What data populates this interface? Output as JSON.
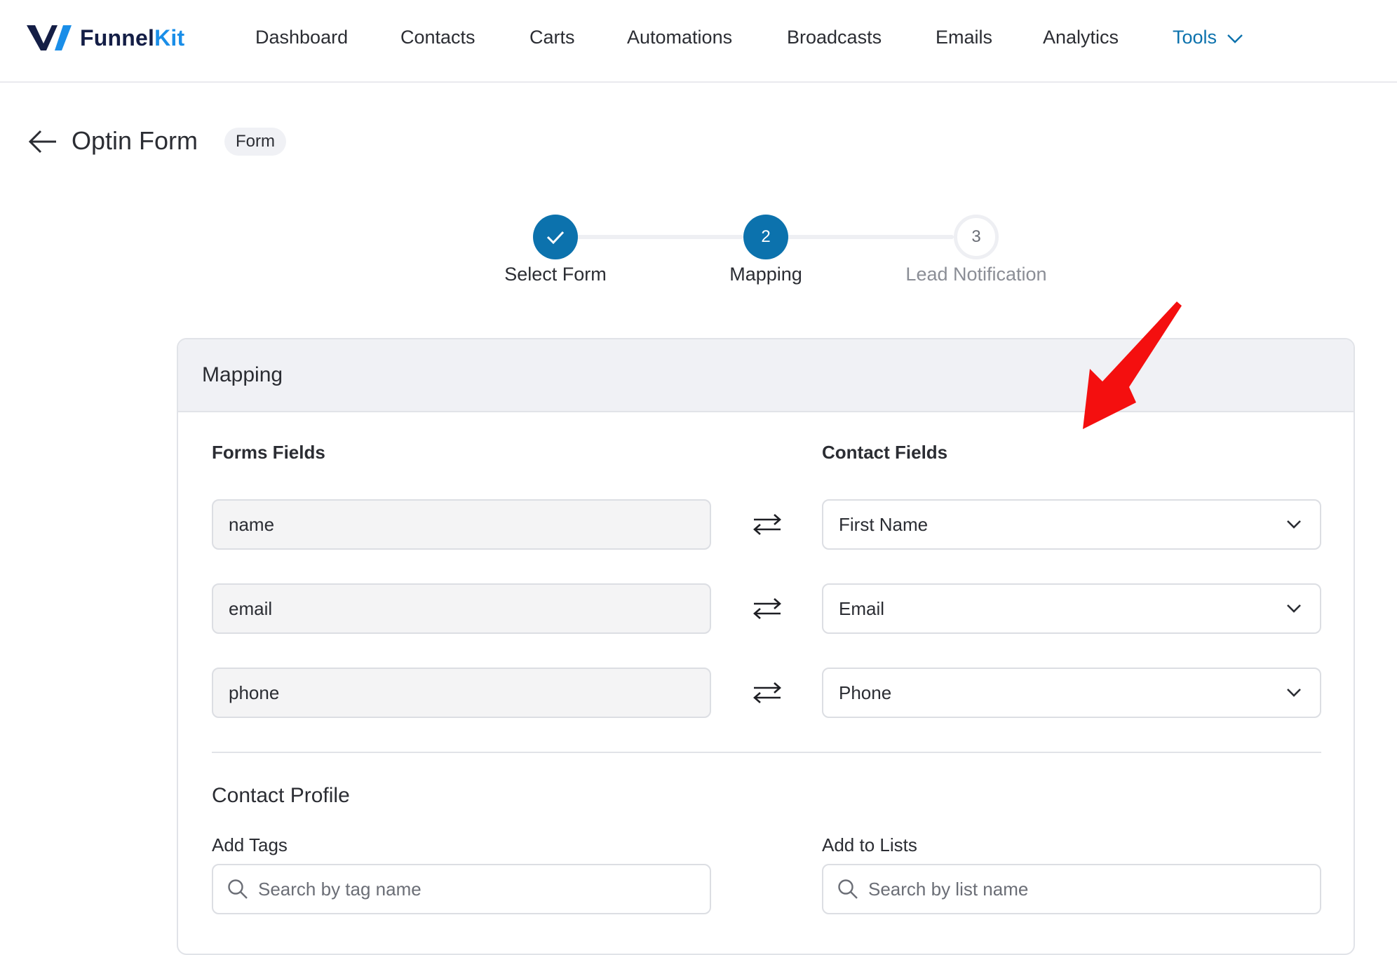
{
  "brand": {
    "part1": "Funnel",
    "part2": "Kit",
    "accent": "#1a8ee8",
    "dark": "#141e46"
  },
  "nav": {
    "items": [
      "Dashboard",
      "Contacts",
      "Carts",
      "Automations",
      "Broadcasts",
      "Emails",
      "Analytics"
    ],
    "tools": "Tools",
    "active_color": "#0c72ad"
  },
  "header": {
    "title": "Optin Form",
    "badge": "Form"
  },
  "stepper": {
    "steps": [
      {
        "number": "1",
        "label": "Select Form",
        "state": "done"
      },
      {
        "number": "2",
        "label": "Mapping",
        "state": "current"
      },
      {
        "number": "3",
        "label": "Lead Notification",
        "state": "pending"
      }
    ]
  },
  "card": {
    "title": "Mapping",
    "forms_fields_heading": "Forms Fields",
    "contact_fields_heading": "Contact Fields",
    "rows": [
      {
        "form_field": "name",
        "contact_field": "First Name"
      },
      {
        "form_field": "email",
        "contact_field": "Email"
      },
      {
        "form_field": "phone",
        "contact_field": "Phone"
      }
    ],
    "contact_profile": {
      "title": "Contact Profile",
      "add_tags_label": "Add Tags",
      "tags_placeholder": "Search by tag name",
      "add_lists_label": "Add to Lists",
      "lists_placeholder": "Search by list name"
    }
  },
  "annotation": {
    "color": "#f40f0f"
  }
}
